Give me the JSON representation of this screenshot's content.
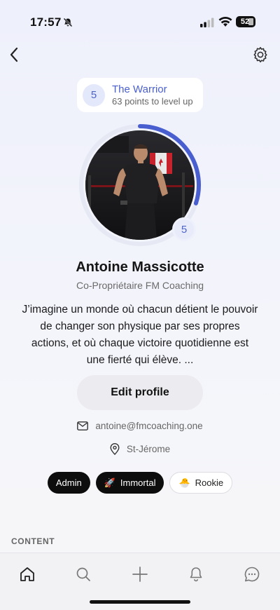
{
  "status_bar": {
    "time": "17:57",
    "battery": "52"
  },
  "level": {
    "number": "5",
    "title": "The Warrior",
    "subtitle": "63 points to level up",
    "progress": 0.3
  },
  "profile": {
    "avatar_level": "5",
    "name": "Antoine Massicotte",
    "role": "Co-Propriétaire FM Coaching",
    "bio": "J’imagine un monde où chacun détient le pouvoir de changer son physique par ses propres actions, et où chaque victoire quotidienne est une fierté qui élève. ...",
    "edit_label": "Edit profile",
    "email": "antoine@fmcoaching.one",
    "location": "St-Jérome"
  },
  "badges": [
    {
      "label": "Admin",
      "emoji": "",
      "style": "dark"
    },
    {
      "label": "Immortal",
      "emoji": "🚀",
      "style": "dark"
    },
    {
      "label": "Rookie",
      "emoji": "🐣",
      "style": "light"
    }
  ],
  "section": {
    "content_label": "CONTENT"
  },
  "tabs": [
    {
      "icon": "home-icon"
    },
    {
      "icon": "search-icon"
    },
    {
      "icon": "plus-icon"
    },
    {
      "icon": "bell-icon"
    },
    {
      "icon": "chat-icon"
    }
  ],
  "colors": {
    "accent": "#4a5fcf",
    "ring_track": "#e6e8f3"
  }
}
